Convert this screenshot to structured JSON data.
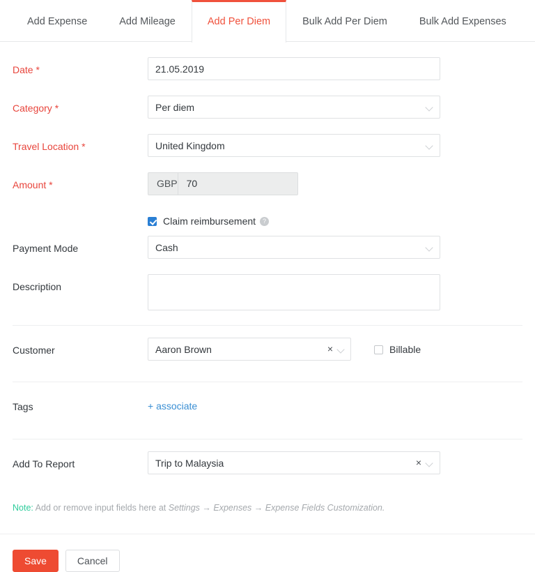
{
  "tabs": [
    {
      "label": "Add Expense",
      "active": false
    },
    {
      "label": "Add Mileage",
      "active": false
    },
    {
      "label": "Add Per Diem",
      "active": true
    },
    {
      "label": "Bulk Add Per Diem",
      "active": false
    },
    {
      "label": "Bulk Add Expenses",
      "active": false
    }
  ],
  "form": {
    "date": {
      "label": "Date",
      "required": true,
      "value": "21.05.2019",
      "placeholder": ""
    },
    "category": {
      "label": "Category",
      "required": true,
      "value": "Per diem",
      "icon": "chevron-down-icon"
    },
    "travel_location": {
      "label": "Travel Location",
      "required": true,
      "value": "United Kingdom",
      "icon": "chevron-down-icon"
    },
    "amount": {
      "label": "Amount",
      "required": true,
      "currency": "GBP",
      "value": "70"
    },
    "claim_reimbursement": {
      "label": "Claim reimbursement",
      "checked": true,
      "help_icon": "help-icon",
      "help_glyph": "?"
    },
    "payment_mode": {
      "label": "Payment Mode",
      "value": "Cash",
      "icon": "chevron-down-icon"
    },
    "description": {
      "label": "Description",
      "value": "",
      "placeholder": ""
    },
    "customer": {
      "label": "Customer",
      "value": "Aaron Brown",
      "clear_glyph": "×",
      "icon": "chevron-down-icon"
    },
    "billable": {
      "label": "Billable",
      "checked": false
    },
    "tags": {
      "label": "Tags",
      "link": "+ associate"
    },
    "add_to_report": {
      "label": "Add To Report",
      "value": "Trip to Malaysia",
      "clear_glyph": "×",
      "icon": "chevron-down-icon"
    }
  },
  "note": {
    "prefix": "Note:",
    "text_before": " Add or remove input fields here at ",
    "path_1": "Settings",
    "arrow_1": " → ",
    "path_2": "Expenses",
    "arrow_2": " → ",
    "path_3": "Expense Fields Customization."
  },
  "footer": {
    "save_label": "Save",
    "cancel_label": "Cancel"
  },
  "colors": {
    "accent_red": "#f0513c",
    "save_red": "#ee4b32",
    "required_red": "#e8453c",
    "link_blue": "#3a8fd4",
    "checkbox_blue": "#2a7fd4",
    "note_green": "#2ecc9b",
    "border_gray": "#dfe1e3",
    "disabled_bg": "#eceded"
  }
}
